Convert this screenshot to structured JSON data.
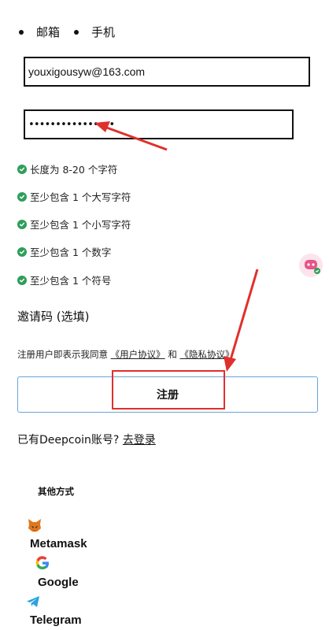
{
  "tabs": {
    "email_label": "邮箱",
    "phone_label": "手机"
  },
  "form": {
    "email_value": "youxigousyw@163.com",
    "password_value": "••••••••••••••••"
  },
  "password_rules": [
    {
      "label": "长度为 8-20 个字符",
      "satisfied": true
    },
    {
      "label": "至少包含 1 个大写字符",
      "satisfied": true
    },
    {
      "label": "至少包含 1 个小写字符",
      "satisfied": true
    },
    {
      "label": "至少包含 1 个数字",
      "satisfied": true
    },
    {
      "label": "至少包含 1 个符号",
      "satisfied": true
    }
  ],
  "invite": {
    "label": "邀请码 (选填)"
  },
  "agreement": {
    "prefix": "注册用户即表示我同意",
    "user_agreement": "《用户协议》",
    "and": "和",
    "privacy_agreement": "《隐私协议》"
  },
  "register": {
    "label": "注册"
  },
  "login": {
    "prompt": "已有Deepcoin账号?",
    "link": "去登录"
  },
  "other_methods": {
    "title": "其他方式",
    "providers": [
      {
        "name": "Metamask",
        "icon": "metamask-fox-icon"
      },
      {
        "name": "Google",
        "icon": "google-g-icon"
      },
      {
        "name": "Telegram",
        "icon": "telegram-plane-icon"
      }
    ]
  },
  "colors": {
    "check": "#2e9e5b",
    "annotation": "#e0302c",
    "button_border": "#6aa4d8"
  }
}
